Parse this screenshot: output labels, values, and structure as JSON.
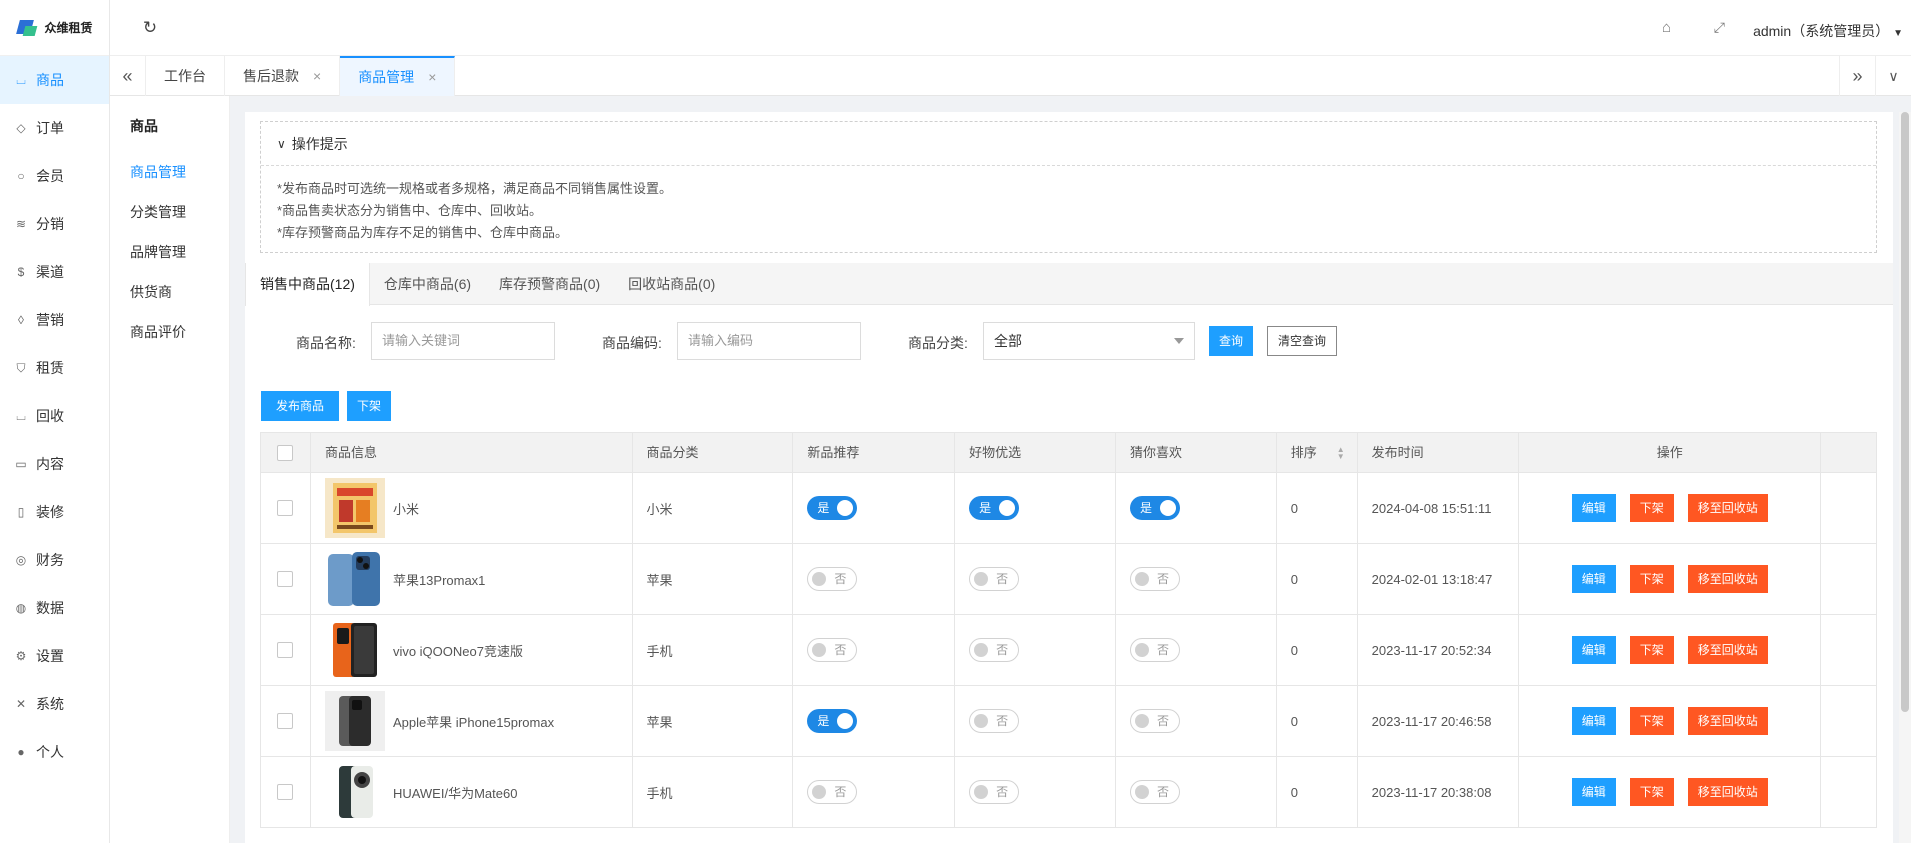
{
  "app": {
    "logo_text": "众维租赁"
  },
  "sidebar": {
    "items": [
      {
        "label": "商品",
        "icon": "cart-icon",
        "active": true
      },
      {
        "label": "订单",
        "icon": "bell-icon"
      },
      {
        "label": "会员",
        "icon": "user-icon"
      },
      {
        "label": "分销",
        "icon": "layers-icon"
      },
      {
        "label": "渠道",
        "icon": "dollar-icon"
      },
      {
        "label": "营销",
        "icon": "diamond-icon"
      },
      {
        "label": "租赁",
        "icon": "shield-icon"
      },
      {
        "label": "回收",
        "icon": "cart-icon"
      },
      {
        "label": "内容",
        "icon": "book-icon"
      },
      {
        "label": "装修",
        "icon": "phone-icon"
      },
      {
        "label": "财务",
        "icon": "finance-icon"
      },
      {
        "label": "数据",
        "icon": "globe-icon"
      },
      {
        "label": "设置",
        "icon": "gear-icon"
      },
      {
        "label": "系统",
        "icon": "tools-icon"
      },
      {
        "label": "个人",
        "icon": "person-icon"
      }
    ]
  },
  "header": {
    "user": "admin（系统管理员）"
  },
  "tabs": [
    {
      "label": "工作台",
      "closable": false,
      "active": false
    },
    {
      "label": "售后退款",
      "closable": true,
      "active": false
    },
    {
      "label": "商品管理",
      "closable": true,
      "active": true
    }
  ],
  "subnav": {
    "title": "商品",
    "items": [
      {
        "label": "商品管理",
        "active": true
      },
      {
        "label": "分类管理"
      },
      {
        "label": "品牌管理"
      },
      {
        "label": "供货商"
      },
      {
        "label": "商品评价"
      }
    ]
  },
  "tips": {
    "title": "操作提示",
    "lines": [
      "*发布商品时可选统一规格或者多规格，满足商品不同销售属性设置。",
      "*商品售卖状态分为销售中、仓库中、回收站。",
      "*库存预警商品为库存不足的销售中、仓库中商品。"
    ]
  },
  "filter_tabs": [
    {
      "label": "销售中商品(12)",
      "active": true
    },
    {
      "label": "仓库中商品(6)"
    },
    {
      "label": "库存预警商品(0)"
    },
    {
      "label": "回收站商品(0)"
    }
  ],
  "search": {
    "name_label": "商品名称:",
    "name_placeholder": "请输入关键词",
    "code_label": "商品编码:",
    "code_placeholder": "请输入编码",
    "category_label": "商品分类:",
    "category_value": "全部",
    "query_button": "查询",
    "clear_button": "清空查询"
  },
  "actions": {
    "publish_button": "发布商品",
    "offshelf_button": "下架"
  },
  "table": {
    "headers": [
      "商品信息",
      "商品分类",
      "新品推荐",
      "好物优选",
      "猜你喜欢",
      "排序",
      "发布时间",
      "操作"
    ],
    "rows": [
      {
        "name": "小米",
        "category": "小米",
        "new": true,
        "good": true,
        "like": true,
        "sort": "0",
        "time": "2024-04-08 15:51:11",
        "thumb": "poster"
      },
      {
        "name": "苹果13Promax1",
        "category": "苹果",
        "new": false,
        "good": false,
        "like": false,
        "sort": "0",
        "time": "2024-02-01 13:18:47",
        "thumb": "iphone-blue"
      },
      {
        "name": "vivo iQOONeo7竞速版",
        "category": "手机",
        "new": false,
        "good": false,
        "like": false,
        "sort": "0",
        "time": "2023-11-17 20:52:34",
        "thumb": "orange-phone"
      },
      {
        "name": "Apple苹果 iPhone15promax",
        "category": "苹果",
        "new": true,
        "good": false,
        "like": false,
        "sort": "0",
        "time": "2023-11-17 20:46:58",
        "thumb": "iphone-dark"
      },
      {
        "name": "HUAWEI/华为Mate60",
        "category": "手机",
        "new": false,
        "good": false,
        "like": false,
        "sort": "0",
        "time": "2023-11-17 20:38:08",
        "thumb": "mate60"
      }
    ],
    "switch_on": "是",
    "switch_off": "否",
    "row_buttons": {
      "edit": "编辑",
      "offshelf": "下架",
      "recycle": "移至回收站"
    }
  },
  "colors": {
    "primary": "#1e9fff",
    "danger": "#ff5722",
    "switch_on": "#1e88e5"
  }
}
